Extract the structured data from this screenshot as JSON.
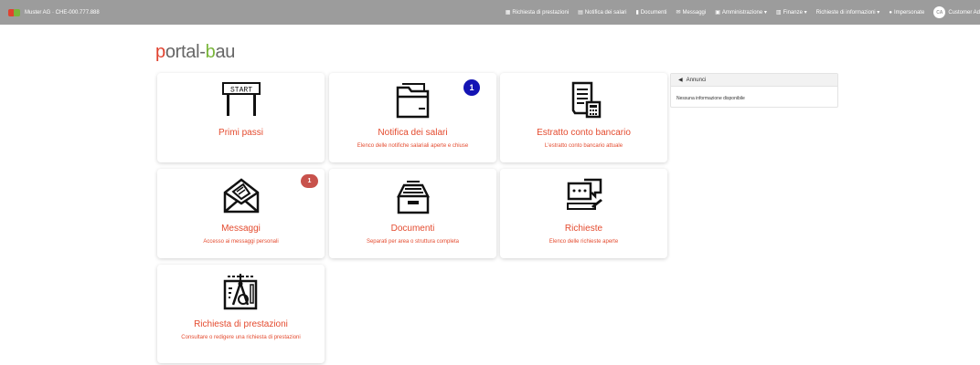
{
  "topbar": {
    "company": "Muster AG · CHE-000.777.888",
    "nav": [
      {
        "label": "Richiesta di prestazioni",
        "icon": "calendar-icon"
      },
      {
        "label": "Notifica dei salari",
        "icon": "table-icon"
      },
      {
        "label": "Documenti",
        "icon": "document-icon"
      },
      {
        "label": "Messaggi",
        "icon": "envelope-icon"
      },
      {
        "label": "Amministrazione ▾",
        "icon": "id-card-icon"
      },
      {
        "label": "Finanze ▾",
        "icon": "money-icon"
      },
      {
        "label": "Richieste di informazioni ▾",
        "icon": ""
      },
      {
        "label": "Impersonate",
        "icon": "user-icon"
      }
    ],
    "avatar_initials": "CA",
    "user_name": "Customer Ad"
  },
  "logo": {
    "p": "p",
    "ortal": "ortal-",
    "b": "b",
    "au": "au"
  },
  "cards": [
    {
      "title": "Primi passi",
      "desc": "",
      "icon": "start-sign-icon"
    },
    {
      "title": "Notifica dei salari",
      "desc": "Elenco delle notifiche salariali aperte e chiuse",
      "icon": "folder-icon",
      "badge": "1"
    },
    {
      "title": "Estratto conto bancario",
      "desc": "L'estratto conto bancario attuale",
      "icon": "receipt-calculator-icon"
    },
    {
      "title": "Messaggi",
      "desc": "Accesso ai messaggi personali",
      "icon": "open-envelope-icon",
      "badge": "1"
    },
    {
      "title": "Documenti",
      "desc": "Separati per area o struttura completa",
      "icon": "file-box-icon"
    },
    {
      "title": "Richieste",
      "desc": "Elenco delle richieste aperte",
      "icon": "chat-computer-icon"
    },
    {
      "title": "Richiesta di prestazioni",
      "desc": "Consultare o redigere una richiesta di prestazioni",
      "icon": "drafting-tools-icon"
    }
  ],
  "annunci": {
    "title": "Annunci",
    "body": "Nessuna informazione disponibile"
  },
  "colors": {
    "accent": "#e44b2f",
    "topbar": "#9c9c9c",
    "badge_blue": "#1414b4",
    "badge_red": "#c8524c",
    "logo_green": "#79b53a"
  }
}
